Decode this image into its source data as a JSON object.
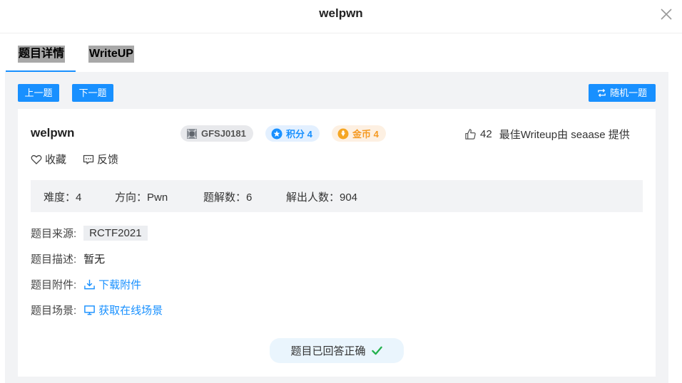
{
  "dialog": {
    "title": "welpwn"
  },
  "tabs": [
    {
      "label": "题目详情"
    },
    {
      "label": "WriteUP"
    }
  ],
  "toolbar": {
    "prev_label": "上一题",
    "next_label": "下一题",
    "random_label": "随机一题"
  },
  "challenge": {
    "title": "welpwn",
    "id_badge": "GFSJ0181",
    "score_badge": "积分 4",
    "coin_badge": "金币 4",
    "likes": "42",
    "writeup_credit": "最佳Writeup由 seaase 提供",
    "favorite_label": "收藏",
    "feedback_label": "反馈"
  },
  "stats": {
    "difficulty": "难度：4",
    "category": "方向：Pwn",
    "solves": "题解数：6",
    "solvers": "解出人数：904"
  },
  "details": {
    "source_label": "题目来源:",
    "source_value": "RCTF2021",
    "desc_label": "题目描述:",
    "desc_value": "暂无",
    "attachment_label": "题目附件:",
    "attachment_link": "下载附件",
    "scene_label": "题目场景:",
    "scene_link": "获取在线场景"
  },
  "status": {
    "answered_label": "题目已回答正确"
  },
  "colors": {
    "accent": "#1890ff",
    "coin": "#f59a23",
    "success": "#22b14c"
  }
}
